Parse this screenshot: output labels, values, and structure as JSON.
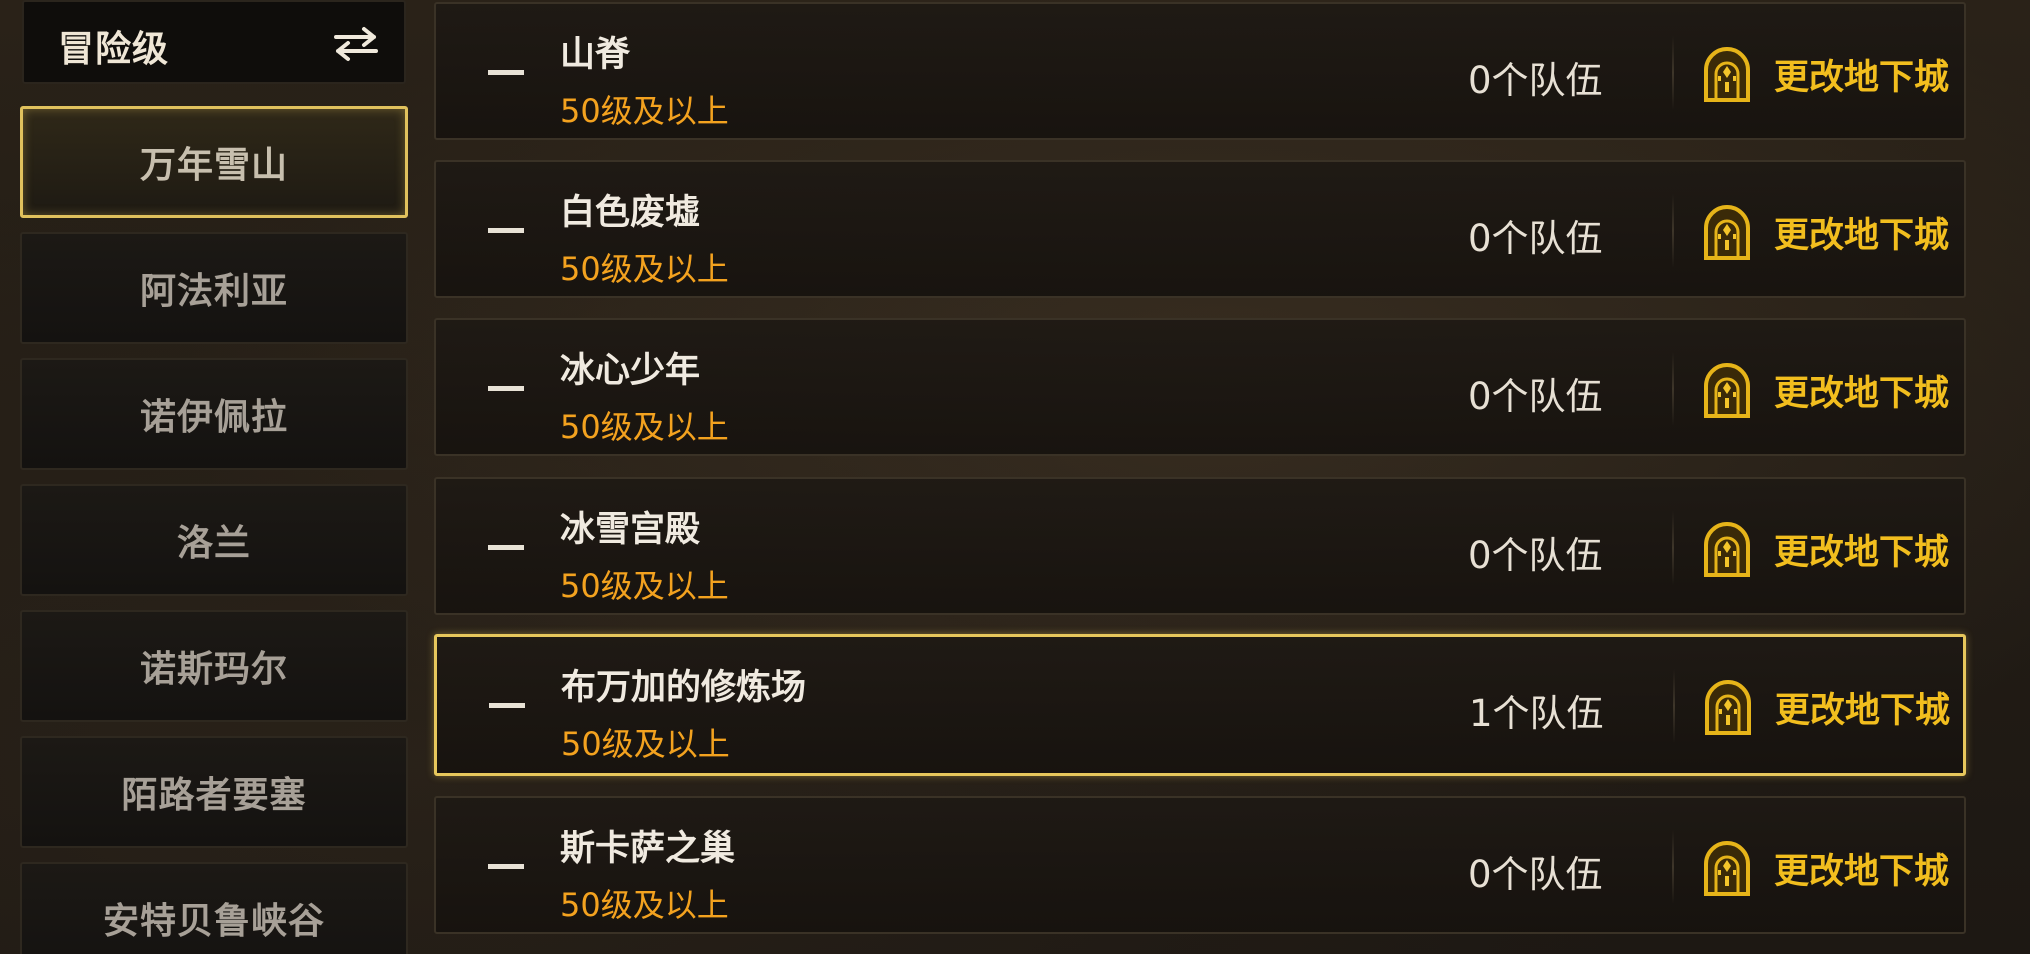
{
  "mode_selector": {
    "label": "冒险级",
    "icon": "swap-arrows-icon"
  },
  "regions": [
    {
      "label": "万年雪山",
      "active": true
    },
    {
      "label": "阿法利亚",
      "active": false
    },
    {
      "label": "诺伊佩拉",
      "active": false
    },
    {
      "label": "洛兰",
      "active": false
    },
    {
      "label": "诺斯玛尔",
      "active": false
    },
    {
      "label": "陌路者要塞",
      "active": false
    },
    {
      "label": "安特贝鲁峡谷",
      "active": false
    }
  ],
  "dungeons": [
    {
      "name": "山脊",
      "level": "50级及以上",
      "teams": "0个队伍",
      "action": "更改地下城",
      "selected": false
    },
    {
      "name": "白色废墟",
      "level": "50级及以上",
      "teams": "0个队伍",
      "action": "更改地下城",
      "selected": false
    },
    {
      "name": "冰心少年",
      "level": "50级及以上",
      "teams": "0个队伍",
      "action": "更改地下城",
      "selected": false
    },
    {
      "name": "冰雪宫殿",
      "level": "50级及以上",
      "teams": "0个队伍",
      "action": "更改地下城",
      "selected": false
    },
    {
      "name": "布万加的修炼场",
      "level": "50级及以上",
      "teams": "1个队伍",
      "action": "更改地下城",
      "selected": true
    },
    {
      "name": "斯卡萨之巢",
      "level": "50级及以上",
      "teams": "0个队伍",
      "action": "更改地下城",
      "selected": false
    }
  ],
  "colors": {
    "accent_gold": "#e7c75c",
    "level_orange": "#f3a21f",
    "action_yellow": "#f2be1e"
  }
}
